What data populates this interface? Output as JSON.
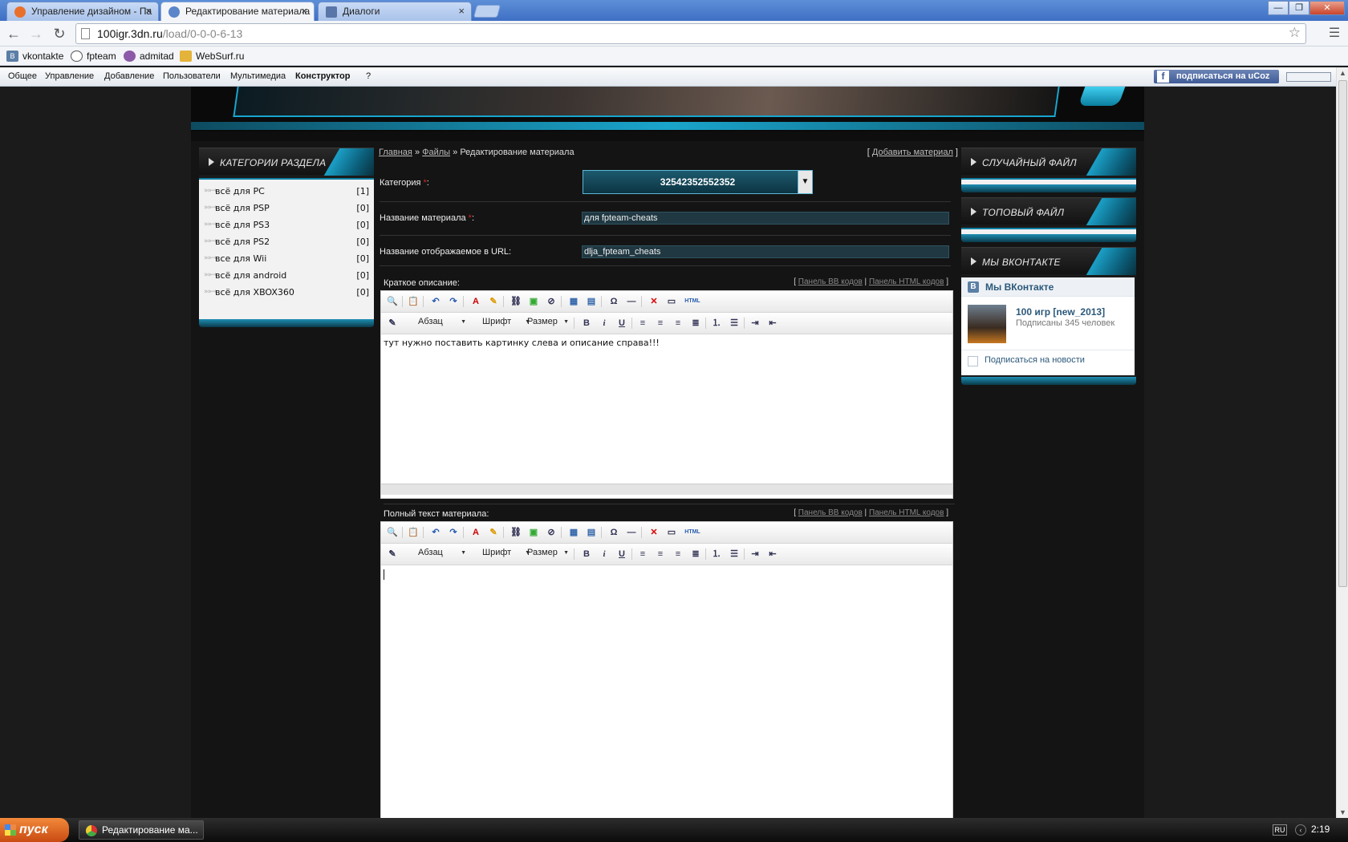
{
  "browser": {
    "tabs": [
      {
        "title": "Управление дизайном - Па"
      },
      {
        "title": "Редактирование материала"
      },
      {
        "title": "Диалоги"
      }
    ],
    "close_glyph": "×",
    "url_host": "100igr.3dn.ru",
    "url_path": "/load/0-0-0-6-13",
    "bookmarks": [
      {
        "label": "vkontakte",
        "icon": "vk-icon"
      },
      {
        "label": "fpteam",
        "icon": "skull-icon"
      },
      {
        "label": "admitad",
        "icon": "admitad-icon"
      },
      {
        "label": "WebSurf.ru",
        "icon": "websurf-icon"
      }
    ]
  },
  "ucoz_panel": {
    "menu": [
      "Общее",
      "Управление",
      "Добавление",
      "Пользователи",
      "Мультимедиа",
      "Конструктор",
      "?"
    ],
    "subscribe": "подписаться на uCoz"
  },
  "left_block": {
    "title": "КАТЕГОРИИ РАЗДЕЛА",
    "items": [
      {
        "label": "всё для PC",
        "count": "[1]"
      },
      {
        "label": "всё для PSP",
        "count": "[0]"
      },
      {
        "label": "всё для PS3",
        "count": "[0]"
      },
      {
        "label": "всё для PS2",
        "count": "[0]"
      },
      {
        "label": "все для Wii",
        "count": "[0]"
      },
      {
        "label": "всё для android",
        "count": "[0]"
      },
      {
        "label": "всё для XBOX360",
        "count": "[0]"
      }
    ]
  },
  "breadcrumbs": {
    "home": "Главная",
    "sep": "»",
    "files": "Файлы",
    "current": "Редактирование материала",
    "add_link": "Добавить материал"
  },
  "form": {
    "category_label": "Категория",
    "category_value": "32542352552352",
    "title_label": "Название материала",
    "title_value": "для fpteam-cheats",
    "url_label": "Название отображаемое в URL:",
    "url_value": "dlja_fpteam_cheats",
    "short_label": "Краткое описание:",
    "full_label": "Полный текст материала:",
    "panel_bb": "Панель BB кодов",
    "panel_html": "Панель HTML кодов",
    "short_text": "тут нужно поставить картинку слева и описание справа!!!",
    "full_text": ""
  },
  "editor_toolbar": {
    "paragraph": "Абзац",
    "font": "Шрифт",
    "size": "Размер",
    "bold": "B",
    "italic": "i",
    "underline": "U",
    "html_btn": "HTML"
  },
  "right_blocks": {
    "random": "СЛУЧАЙНЫЙ ФАЙЛ",
    "top": "ТОПОВЫЙ ФАЙЛ",
    "vk": "МЫ ВКОНТАКТЕ"
  },
  "vk_widget": {
    "header": "Мы ВКонтакте",
    "group_name": "100 игр [new_2013]",
    "subscribers": "Подписаны 345 человек",
    "subscribe": "Подписаться на новости"
  },
  "taskbar": {
    "start": "пуск",
    "task": "Редактирование ма...",
    "lang": "RU",
    "clock": "2:19"
  }
}
